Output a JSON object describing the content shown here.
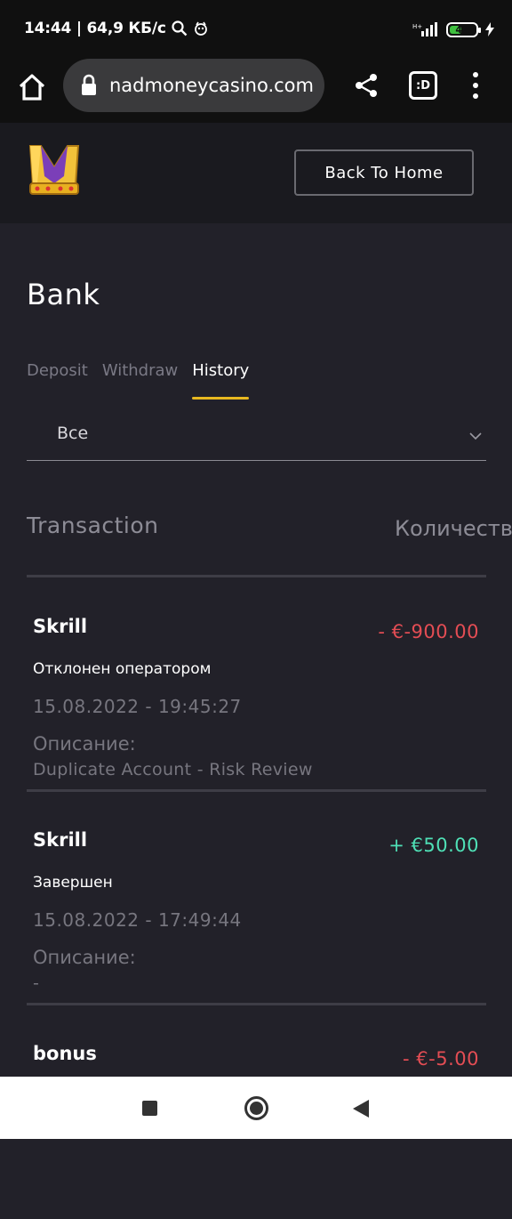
{
  "status_bar": {
    "left_text": "14:44 | 64,9 КБ/с",
    "battery_level": "40",
    "icons": [
      "search-icon",
      "mascot-icon",
      "signal-icon",
      "battery-icon",
      "charging-icon"
    ]
  },
  "browser": {
    "url": "nadmoneycasino.com",
    "tab_count": ":D",
    "icons": [
      "home-icon",
      "lock-icon",
      "share-icon",
      "tabs-icon",
      "more-vert-icon"
    ]
  },
  "header": {
    "back_label": "Back To Home",
    "logo": "crown-m-logo"
  },
  "page": {
    "title": "Bank",
    "tabs": [
      {
        "label": "Deposit",
        "active": false
      },
      {
        "label": "Withdraw",
        "active": false
      },
      {
        "label": "History",
        "active": true
      }
    ],
    "filter": {
      "value": "Все"
    },
    "columns": {
      "transaction": "Transaction",
      "amount": "Количество"
    }
  },
  "transactions": [
    {
      "method": "Skrill",
      "amount": "- €-900.00",
      "sign": "negative",
      "status": "Отклонен оператором",
      "date": "15.08.2022 - 19:45:27",
      "desc_label": "Описание:",
      "desc": "Duplicate Account - Risk Review"
    },
    {
      "method": "Skrill",
      "amount": "+ €50.00",
      "sign": "positive",
      "status": "Завершен",
      "date": "15.08.2022 - 17:49:44",
      "desc_label": "Описание:",
      "desc": "-"
    },
    {
      "method": "bonus",
      "amount": "- €-5.00",
      "sign": "negative"
    }
  ],
  "colors": {
    "background": "#222129",
    "accent": "#e8b820",
    "negative": "#e44d54",
    "positive": "#4fe0b6"
  }
}
